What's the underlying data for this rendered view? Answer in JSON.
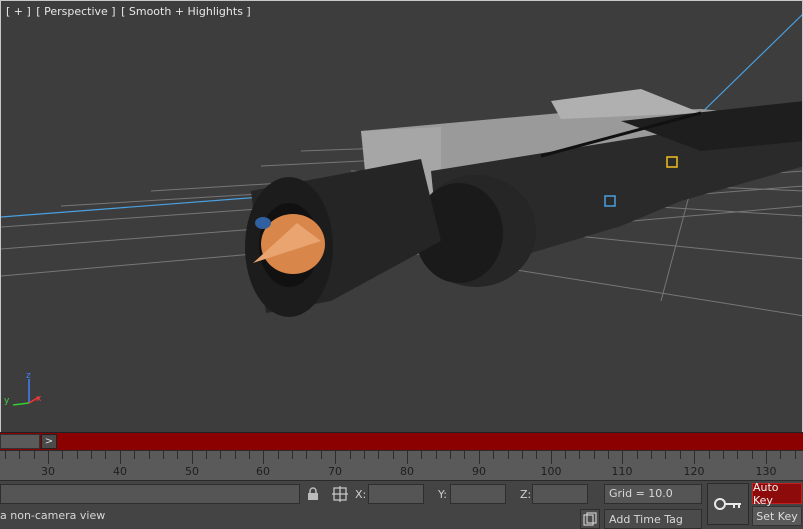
{
  "viewport": {
    "plus_label": "[ + ]",
    "view_label": "[ Perspective ]",
    "shading_label": "[ Smooth + Highlights ]",
    "axis_x": "x",
    "axis_y": "y",
    "axis_z": "z"
  },
  "time_slider": {
    "next_label": ">"
  },
  "ruler": {
    "labels": [
      "30",
      "40",
      "50",
      "60",
      "70",
      "80",
      "90",
      "100",
      "110",
      "120",
      "130"
    ]
  },
  "coords": {
    "x_label": "X:",
    "y_label": "Y:",
    "z_label": "Z:",
    "x_value": "",
    "y_value": "",
    "z_value": ""
  },
  "grid": {
    "text": "Grid = 10.0"
  },
  "keys": {
    "auto_key": "Auto Key",
    "set_key": "Set Key"
  },
  "status": {
    "prompt": "a non-camera view",
    "add_time_tag": "Add Time Tag"
  },
  "colors": {
    "time_bar": "#8b0000",
    "auto_key_bg": "#8e0b0b",
    "selection_blue": "#4aa0e0",
    "helper_yellow": "#f0c020",
    "bullet_copper": "#d9864a"
  }
}
